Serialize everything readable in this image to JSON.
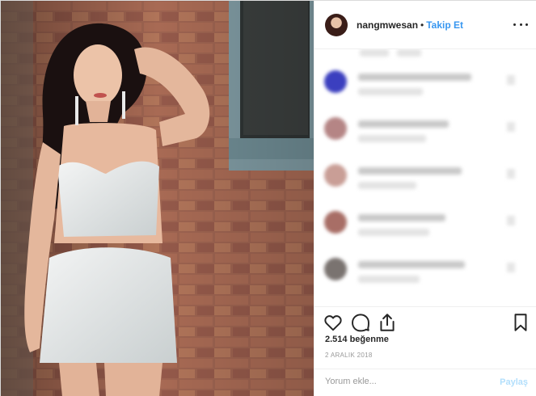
{
  "header": {
    "username": "nangmwesan",
    "separator": "•",
    "follow_label": "Takip Et"
  },
  "post": {
    "likes_text": "2.514 beğenme",
    "date_text": "2 ARALIK 2018"
  },
  "comment_bar": {
    "placeholder": "Yorum ekle...",
    "post_label": "Paylaş"
  },
  "icons": {
    "like": "heart-icon",
    "comment": "comment-icon",
    "share": "share-icon",
    "save": "bookmark-icon",
    "more": "more-options-icon"
  },
  "colors": {
    "accent": "#3897f0",
    "post_disabled": "#b2dffc",
    "text": "#262626",
    "muted": "#999999"
  }
}
